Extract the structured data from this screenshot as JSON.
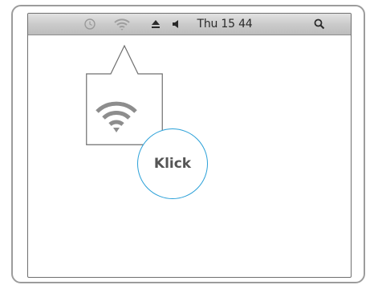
{
  "menubar": {
    "icons": {
      "sync": "sync-clock-icon",
      "wifi": "wifi-icon",
      "eject": "eject-icon",
      "volume": "volume-icon",
      "search": "spotlight-search-icon"
    },
    "clock": "Thu 15 44"
  },
  "popup": {
    "icon": "wifi-icon"
  },
  "callout": {
    "label": "Klick",
    "accent_color": "#2aa0d8"
  }
}
